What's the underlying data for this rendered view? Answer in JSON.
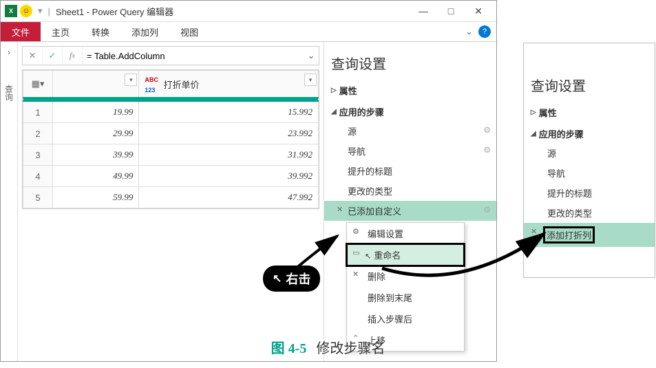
{
  "window": {
    "title": "Sheet1 - Power Query 编辑器"
  },
  "ribbon": {
    "file": "文件",
    "tabs": [
      "主页",
      "转换",
      "添加列",
      "视图"
    ]
  },
  "sidebar": {
    "label": "查询"
  },
  "formula": {
    "value": "= Table.AddColumn"
  },
  "grid": {
    "col2": "打折单价",
    "rows": [
      {
        "n": "1",
        "a": "19.99",
        "b": "15.992"
      },
      {
        "n": "2",
        "a": "29.99",
        "b": "23.992"
      },
      {
        "n": "3",
        "a": "39.99",
        "b": "31.992"
      },
      {
        "n": "4",
        "a": "49.99",
        "b": "39.992"
      },
      {
        "n": "5",
        "a": "59.99",
        "b": "47.992"
      }
    ]
  },
  "settings": {
    "title": "查询设置",
    "properties": "属性",
    "applied": "应用的步骤",
    "steps": [
      "源",
      "导航",
      "提升的标题",
      "更改的类型",
      "已添加自定义"
    ]
  },
  "ctx": {
    "edit": "编辑设置",
    "rename": "重命名",
    "delete": "删除",
    "deleteToEnd": "删除到末尾",
    "insertAfter": "插入步骤后",
    "moveUp": "上移"
  },
  "panel2": {
    "title": "查询设置",
    "properties": "属性",
    "applied": "应用的步骤",
    "steps": [
      "源",
      "导航",
      "提升的标题",
      "更改的类型"
    ],
    "final": "添加打折列"
  },
  "badge": {
    "text": "右击"
  },
  "caption": {
    "fig": "图 4-5",
    "text": "修改步骤名"
  }
}
